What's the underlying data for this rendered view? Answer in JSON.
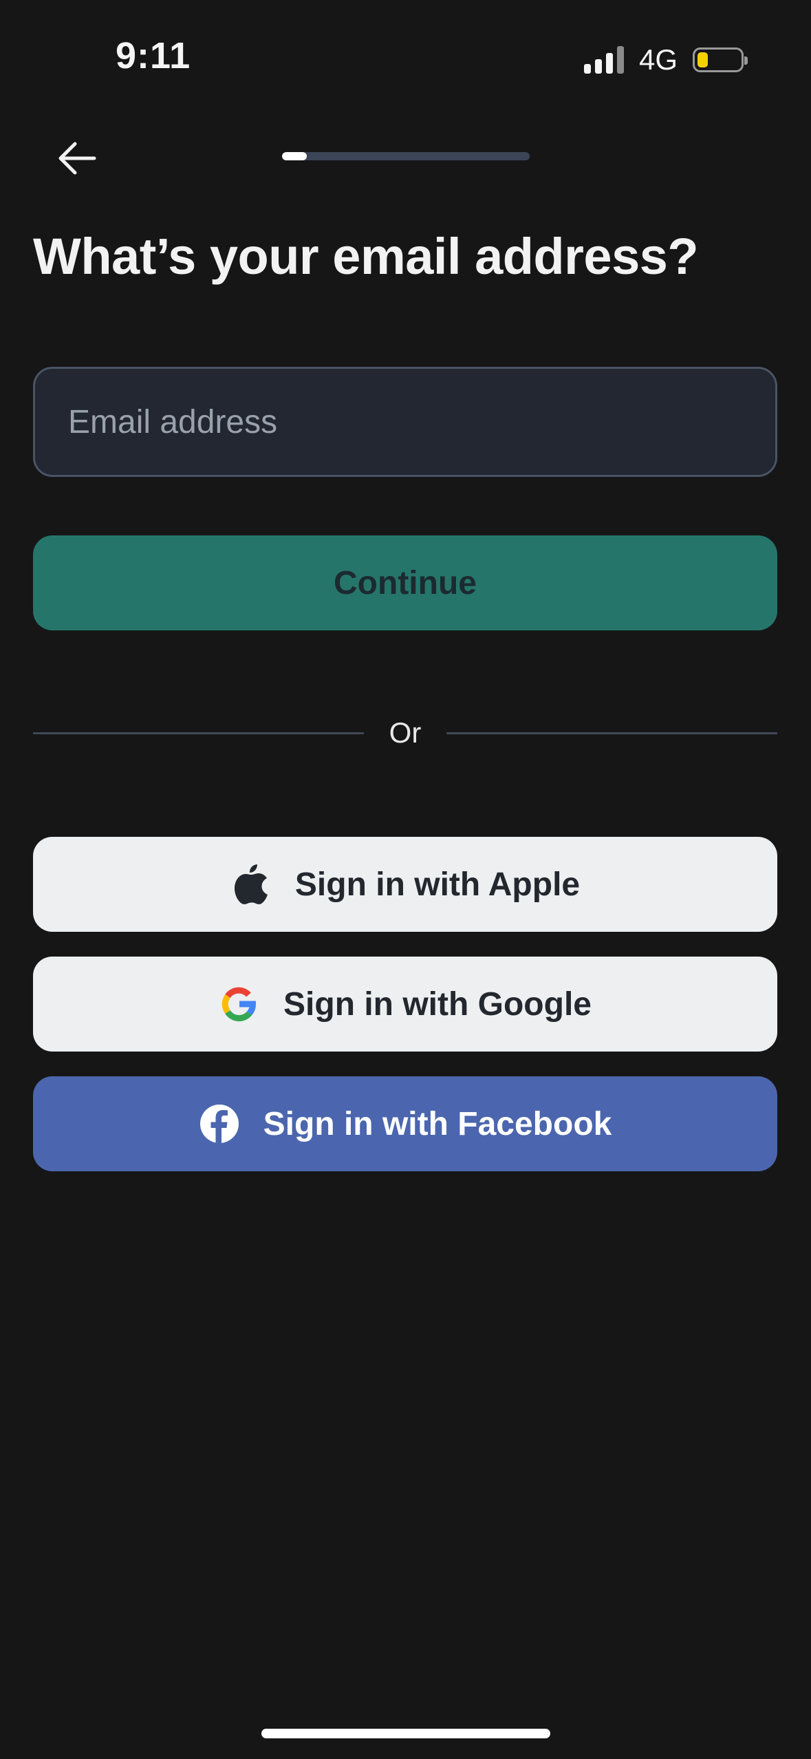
{
  "status_bar": {
    "time": "9:11",
    "network": "4G",
    "battery_level": 0.25,
    "battery_color": "#f5d000"
  },
  "header": {
    "back_icon": "arrow-left-icon",
    "progress": 0.1
  },
  "page": {
    "title": "What’s your email address?"
  },
  "email_form": {
    "email_placeholder": "Email address",
    "email_value": "",
    "continue_label": "Continue"
  },
  "divider": {
    "label": "Or"
  },
  "social_login": {
    "apple_label": "Sign in with Apple",
    "apple_icon": "apple-logo-icon",
    "google_label": "Sign in with Google",
    "google_icon": "google-logo-icon",
    "facebook_label": "Sign in with Facebook",
    "facebook_icon": "facebook-logo-icon"
  },
  "colors": {
    "background": "#161616",
    "accent": "#25756a",
    "facebook_blue": "#4b66ae",
    "light_button": "#eeeff1"
  }
}
